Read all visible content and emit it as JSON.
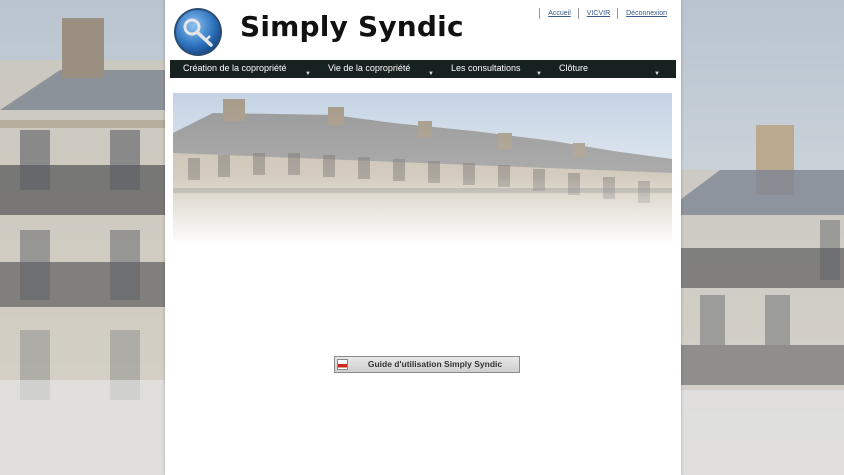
{
  "header": {
    "brand": "Simply Syndic",
    "logo_icon": "key-globe-icon"
  },
  "toplinks": [
    {
      "label": "Accueil"
    },
    {
      "label": "VICVIR"
    },
    {
      "label": "Déconnexion"
    }
  ],
  "menu": [
    {
      "label": "Création de la copropriété"
    },
    {
      "label": "Vie de la copropriété"
    },
    {
      "label": "Les consultations"
    },
    {
      "label": "Clôture"
    }
  ],
  "guide": {
    "label": "Guide d'utilisation Simply Syndic",
    "icon": "pdf-icon"
  },
  "colors": {
    "menubar": "#17211f",
    "link": "#3a5a8a"
  }
}
